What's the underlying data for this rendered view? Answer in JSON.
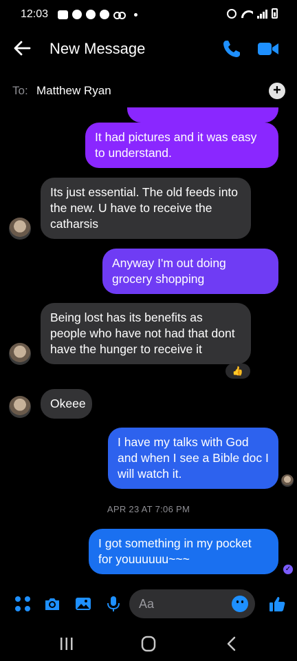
{
  "status": {
    "time": "12:03"
  },
  "header": {
    "title": "New Message"
  },
  "to": {
    "label": "To:",
    "name": "Matthew Ryan",
    "add": "+"
  },
  "messages": [
    {
      "text": "It had pictures and it was easy to understand."
    },
    {
      "text": "Its just essential. The old feeds into the new. U have to receive the catharsis"
    },
    {
      "text": "Anyway I'm out doing grocery shopping"
    },
    {
      "text": "Being lost has its benefits as people who have not had that dont have the hunger to receive it",
      "reaction": "👍"
    },
    {
      "text": "Okeee"
    },
    {
      "text": "I have my talks with God and when I see a Bible doc I will watch it."
    },
    {
      "text": "I got something in my pocket for youuuuuu~~~"
    }
  ],
  "separator": "APR 23 AT 7:06 PM",
  "composer": {
    "placeholder": "Aa"
  },
  "colors": {
    "accent": "#1e90ff",
    "sent_purple": "#8a27ff",
    "sent_blue": "#2d62ee",
    "received": "#333335"
  }
}
